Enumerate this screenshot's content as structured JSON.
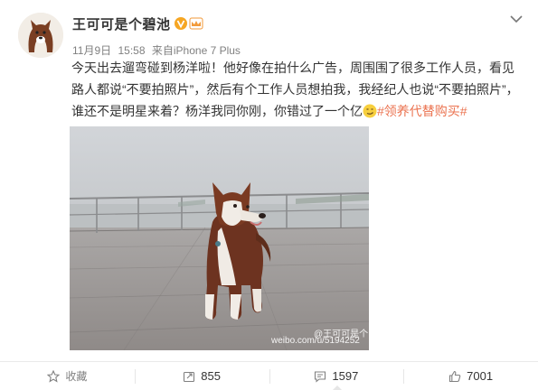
{
  "user": {
    "name": "王可可是个碧池",
    "verified_icon": "v-badge-icon",
    "member_icon": "crown-icon"
  },
  "meta": {
    "date": "11月9日",
    "time": "15:58",
    "source_prefix": "来自",
    "source": "iPhone 7 Plus"
  },
  "post": {
    "line1": "今天出去遛弯碰到杨洋啦！他好像在拍什么广告，周围围了很多工作人员，看见",
    "line2": "路人都说“不要拍照片”，然后有个工作人员想拍我，我经纪人也说“不要拍照片”，",
    "line3_text": "谁还不是明星来着？杨洋我同你刚，你错过了一个亿",
    "line3_hashtag": "#领养代替购买#",
    "emoji": "smirk-emoji-icon"
  },
  "photo": {
    "subject": "dog-photo",
    "watermark_line1": "@王可可是个",
    "watermark_line2": "weibo.com/u/5194252"
  },
  "actions": {
    "favorite_label": "收藏",
    "repost_count": "855",
    "comment_count": "1597",
    "like_count": "7001"
  },
  "colors": {
    "hashtag": "#eb7350",
    "verified": "#f6a623",
    "text": "#333333",
    "meta": "#808080"
  }
}
